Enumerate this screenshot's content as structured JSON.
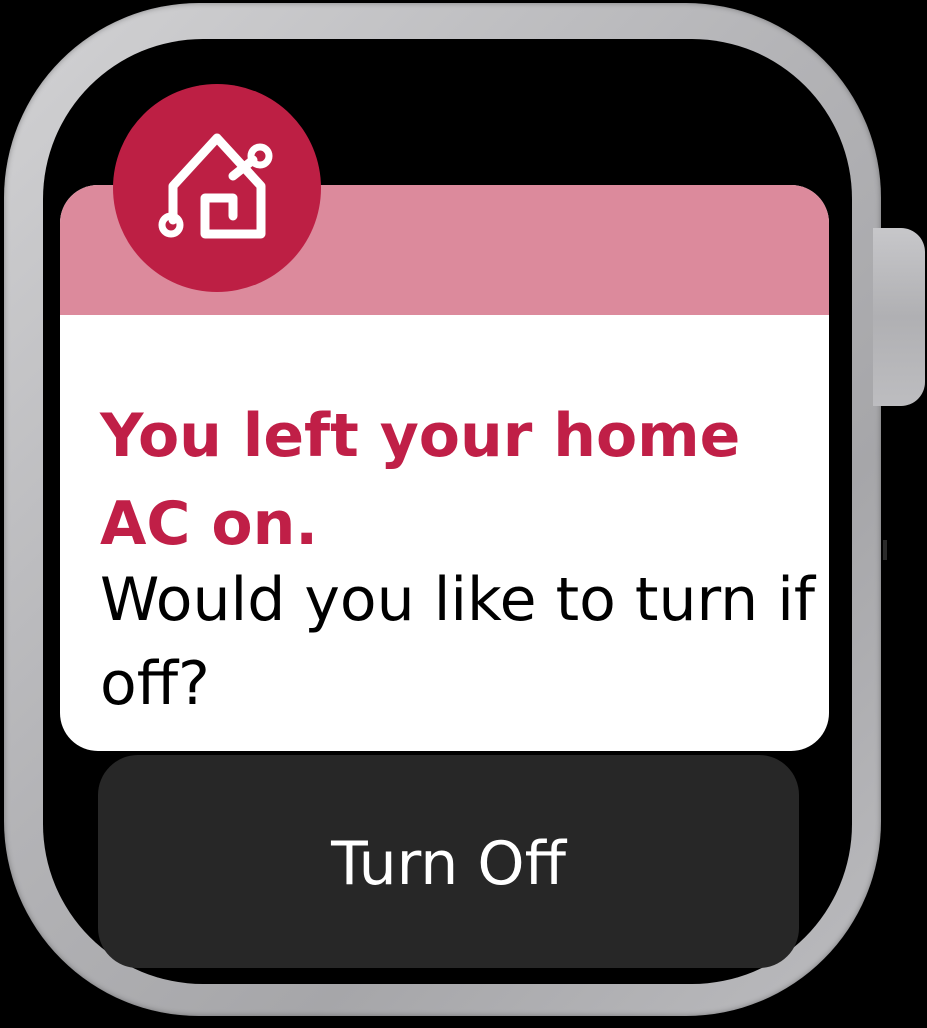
{
  "notification": {
    "app_icon": "smart-home-icon",
    "title": "You left your home AC on.",
    "body": "Would you like to turn if off?"
  },
  "actions": {
    "turn_off_label": "Turn Off"
  },
  "colors": {
    "accent": "#bd1f44",
    "title_text": "#c01f47",
    "header_band": "#dc8a9c",
    "card_background": "#ffffff",
    "button_background": "#272727",
    "button_text": "#ffffff",
    "screen_background": "#000000",
    "frame": "#b8b8bb"
  }
}
